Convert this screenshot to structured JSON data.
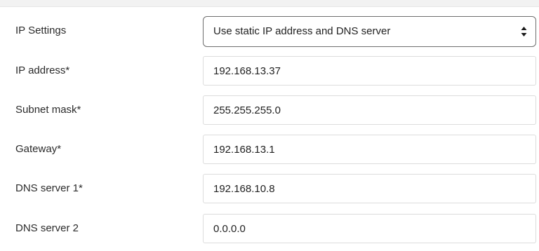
{
  "ip_settings": {
    "label": "IP Settings",
    "selected_option": "Use static IP address and DNS server"
  },
  "fields": [
    {
      "label": "IP address*",
      "value": "192.168.13.37"
    },
    {
      "label": "Subnet mask*",
      "value": "255.255.255.0"
    },
    {
      "label": "Gateway*",
      "value": "192.168.13.1"
    },
    {
      "label": "DNS server 1*",
      "value": "192.168.10.8"
    },
    {
      "label": "DNS server 2",
      "value": "0.0.0.0"
    }
  ],
  "icons": {
    "select_indicator": "up-down-chevron-icon"
  }
}
